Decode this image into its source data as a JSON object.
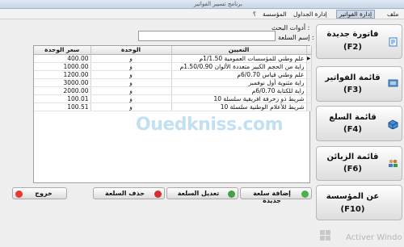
{
  "window": {
    "title": "برنامج تسيير الفواتير"
  },
  "menu": [
    {
      "label": "ملف",
      "active": false
    },
    {
      "label": "إدارة الفواتير",
      "active": true
    },
    {
      "label": "إدارة الجداول",
      "active": false
    },
    {
      "label": "المؤسسة",
      "active": false
    },
    {
      "label": "؟",
      "active": false
    }
  ],
  "search": {
    "title": "أدوات البحث :",
    "name_label": "إسم السلعة :",
    "name_value": ""
  },
  "table": {
    "columns": [
      "سعر الوحدة",
      "الوحدة",
      "التعيين"
    ],
    "rows": [
      {
        "price": "400.00",
        "unit": "و",
        "designation": "علم وطني للمؤسسات العمومية 1/1.50م",
        "selected": true
      },
      {
        "price": "1000.00",
        "unit": "و",
        "designation": "راية من الحجم الكبير متعددة الألوان 1.50/0.90م",
        "selected": false
      },
      {
        "price": "1200.00",
        "unit": "و",
        "designation": "علم وطني قياس 6/0.70م",
        "selected": false
      },
      {
        "price": "3000.00",
        "unit": "و",
        "designation": "راية مثنوية أول نوفمبر",
        "selected": false
      },
      {
        "price": "2000.00",
        "unit": "و",
        "designation": "راية للكتابة 6/0.70م",
        "selected": false
      },
      {
        "price": "100.01",
        "unit": "و",
        "designation": "شريط ذو زخرفة افريقية سلسلة 10",
        "selected": false
      },
      {
        "price": "100.51",
        "unit": "و",
        "designation": "شريط للأعلام الوطنية سلسلة 10",
        "selected": false
      }
    ]
  },
  "side_buttons": [
    {
      "line1": "فاتورة جديدة",
      "line2": "(F2)",
      "icon": "new-invoice-icon"
    },
    {
      "line1": "قائمة الفواتير",
      "line2": "(F3)",
      "icon": "invoice-list-icon"
    },
    {
      "line1": "قائمة السلع",
      "line2": "(F4)",
      "icon": "goods-list-icon"
    },
    {
      "line1": "قائمة الزبائن",
      "line2": "(F6)",
      "icon": "customers-list-icon"
    },
    {
      "line1": "عن المؤسسة",
      "line2": "(F10)",
      "icon": "company-info-icon"
    }
  ],
  "bottom_buttons": {
    "add": "إضافة سلعة جديدة",
    "edit": "تعديل السلعة",
    "delete": "حذف السلعة",
    "exit": "خروج"
  },
  "watermark": "Ouedkniss.com",
  "os_overlay": {
    "activate_text": "Activer Windo"
  },
  "colors": {
    "watermark": "#8fc9ea",
    "add_icon": "#4caf50",
    "delete_icon": "#d32f2f",
    "exit_icon": "#e53935"
  }
}
